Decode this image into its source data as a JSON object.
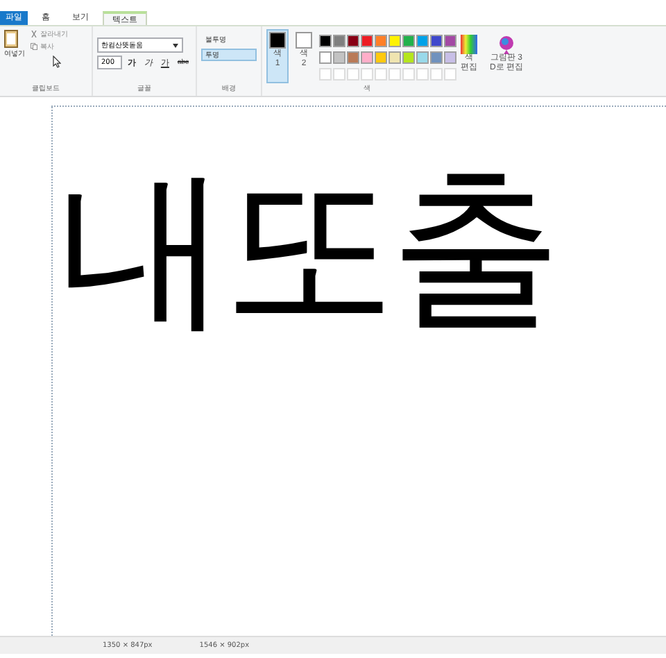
{
  "tabs": [
    {
      "label": "파일",
      "kind": "file",
      "selected": false
    },
    {
      "label": "홈",
      "kind": "normal",
      "selected": false
    },
    {
      "label": "보기",
      "kind": "normal",
      "selected": false
    },
    {
      "label": "텍스트",
      "kind": "normal",
      "selected": true
    }
  ],
  "clipboard": {
    "paste": "여넣기",
    "cut": "잘라내기",
    "copy": "복사",
    "label": "클립보드"
  },
  "font": {
    "family": "한컴산뜻돋움",
    "size": "200",
    "styles": [
      {
        "label": "가",
        "kind": "bold"
      },
      {
        "label": "가",
        "kind": "italic"
      },
      {
        "label": "가",
        "kind": "underline"
      },
      {
        "label": "abc",
        "kind": "strike"
      }
    ],
    "label": "글꼴"
  },
  "background": {
    "options": [
      {
        "label": "불투명",
        "selected": false
      },
      {
        "label": "투명",
        "selected": true
      }
    ],
    "label": "배경"
  },
  "colors": {
    "slots": [
      {
        "label": "색\n1",
        "color": "#000000",
        "selected": true
      },
      {
        "label": "색\n2",
        "color": "#ffffff",
        "selected": false
      }
    ],
    "palette": [
      {
        "color": "#000000"
      },
      {
        "color": "#7f7f7f"
      },
      {
        "color": "#880015"
      },
      {
        "color": "#ed1c24"
      },
      {
        "color": "#ff7f27"
      },
      {
        "color": "#fff200"
      },
      {
        "color": "#22b14c"
      },
      {
        "color": "#00a2e8"
      },
      {
        "color": "#3f48cc"
      },
      {
        "color": "#a349a4"
      },
      {
        "color": "#ffffff"
      },
      {
        "color": "#c3c3c3"
      },
      {
        "color": "#b97a57"
      },
      {
        "color": "#ffaec9"
      },
      {
        "color": "#ffc90e"
      },
      {
        "color": "#efe4b0"
      },
      {
        "color": "#b5e61d"
      },
      {
        "color": "#99d9ea"
      },
      {
        "color": "#7092be"
      },
      {
        "color": "#c8bfe7"
      }
    ],
    "edit": "색\n편집",
    "paint3d": "그림판 3\nD로 편집",
    "label": "색"
  },
  "canvas": {
    "text": "내또출"
  },
  "status_bar": {
    "selection": "1350 × 847px",
    "image_size": "1546 × 902px"
  }
}
